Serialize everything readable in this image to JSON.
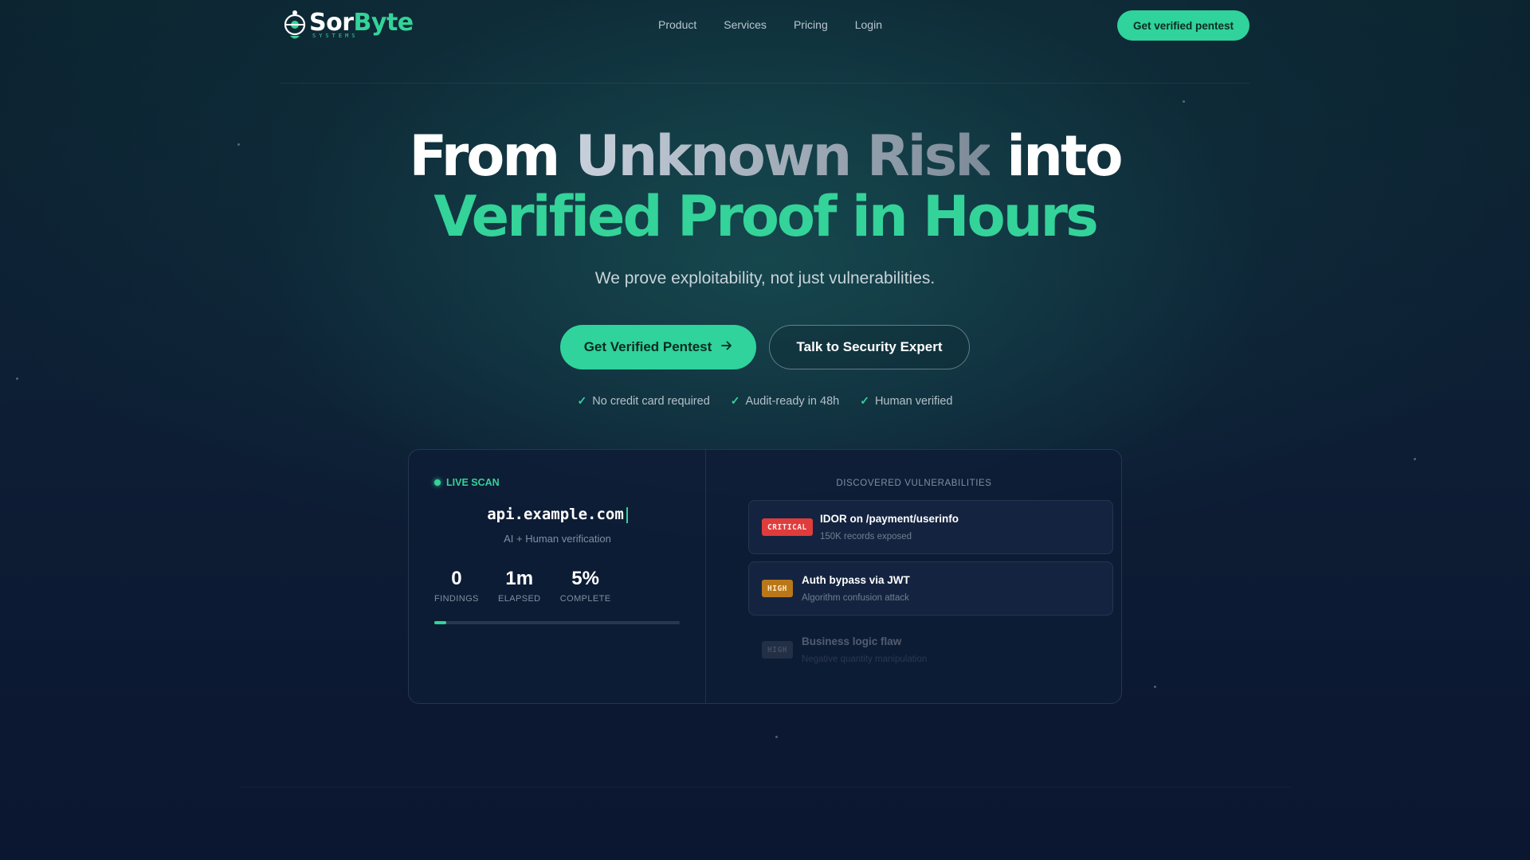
{
  "brand": {
    "name_part1": "Sor",
    "name_part2": "Byte",
    "tagline": "SYSTEMS"
  },
  "nav": {
    "links": [
      "Product",
      "Services",
      "Pricing",
      "Login"
    ],
    "cta": "Get verified pentest"
  },
  "hero": {
    "line1_a": "From ",
    "line1_b": "Unknown Risk",
    "line1_c": " into",
    "line2": "Verified Proof in Hours",
    "subtitle": "We prove exploitability, not just vulnerabilities.",
    "primary_cta": "Get Verified Pentest",
    "secondary_cta": "Talk to Security Expert",
    "checks": [
      "No credit card required",
      "Audit-ready in 48h",
      "Human verified"
    ]
  },
  "scan": {
    "status": "LIVE SCAN",
    "target": "api.example.com",
    "mode": "AI + Human verification",
    "stats": [
      {
        "value": "0",
        "label": "FINDINGS"
      },
      {
        "value": "1m",
        "label": "ELAPSED"
      },
      {
        "value": "5%",
        "label": "COMPLETE"
      }
    ],
    "progress_fraction": 0.05
  },
  "vulnerabilities": {
    "title": "DISCOVERED VULNERABILITIES",
    "items": [
      {
        "severity": "CRITICAL",
        "name": "IDOR on /payment/userinfo",
        "detail": "150K records exposed"
      },
      {
        "severity": "HIGH",
        "name": "Auth bypass via JWT",
        "detail": "Algorithm confusion attack"
      },
      {
        "severity": "HIGH",
        "name": "Business logic flaw",
        "detail": "Negative quantity manipulation"
      }
    ]
  },
  "colors": {
    "accent": "#34d399",
    "critical": "#e03c3c",
    "high": "#b9771a",
    "background": "#0d1f34"
  }
}
